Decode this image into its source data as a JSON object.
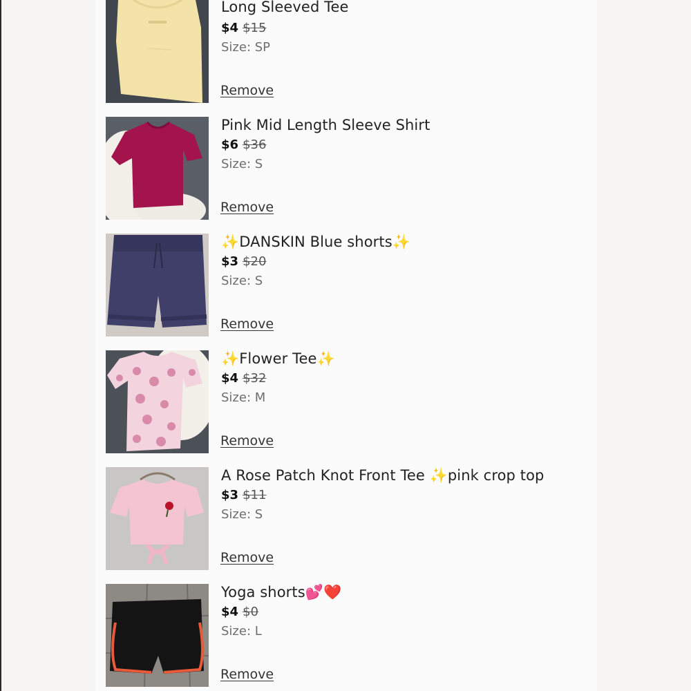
{
  "cart": {
    "remove_label": "Remove",
    "items": [
      {
        "title": "Long Sleeved Tee",
        "price": "$4",
        "original_price": "$15",
        "size": "Size: SP",
        "image": "yellow-tee-photo"
      },
      {
        "title": "Pink Mid Length Sleeve Shirt",
        "price": "$6",
        "original_price": "$36",
        "size": "Size: S",
        "image": "magenta-shirt-photo"
      },
      {
        "title": "✨DANSKIN Blue shorts✨",
        "price": "$3",
        "original_price": "$20",
        "size": "Size: S",
        "image": "navy-shorts-photo"
      },
      {
        "title": "✨Flower Tee✨",
        "price": "$4",
        "original_price": "$32",
        "size": "Size: M",
        "image": "floral-tee-photo"
      },
      {
        "title": "A Rose Patch Knot Front Tee ✨pink crop top",
        "price": "$3",
        "original_price": "$11",
        "size": "Size: S",
        "image": "pink-crop-top-photo"
      },
      {
        "title": "Yoga shorts💕❤️",
        "price": "$4",
        "original_price": "$0",
        "size": "Size: L",
        "image": "black-yoga-shorts-photo"
      }
    ]
  }
}
